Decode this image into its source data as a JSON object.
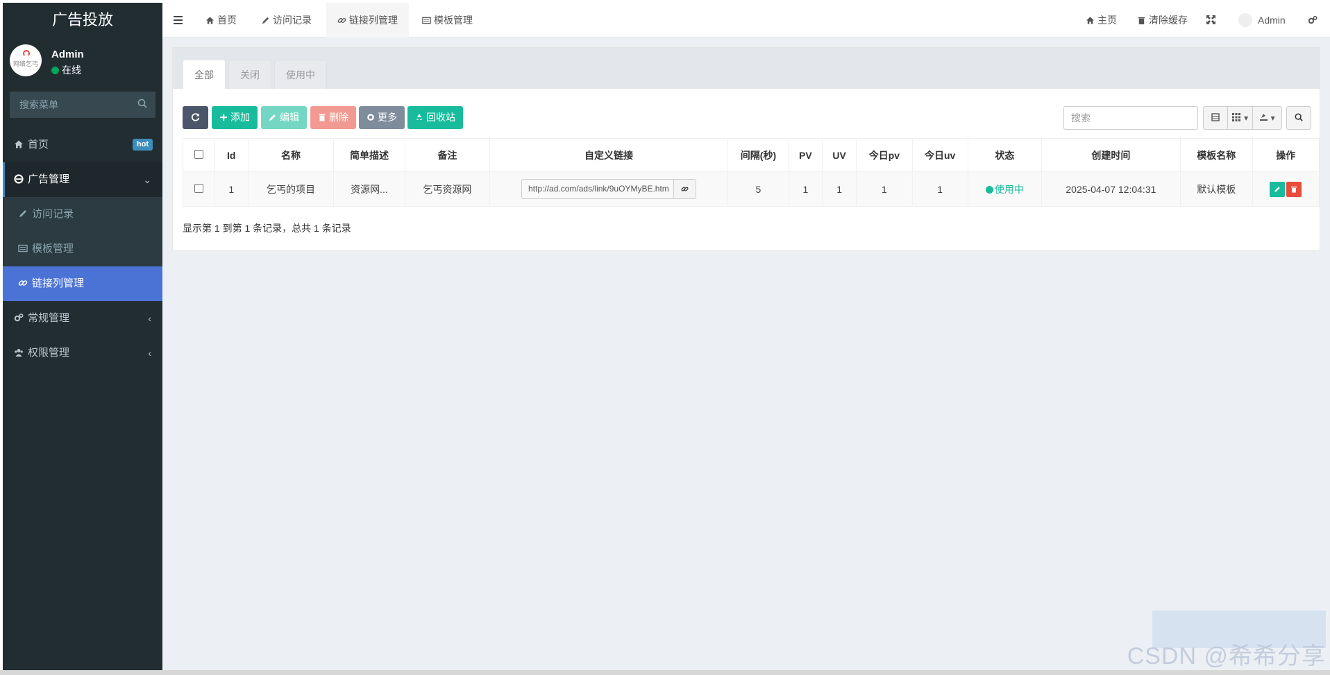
{
  "app": {
    "title": "广告投放"
  },
  "user": {
    "name": "Admin",
    "status": "在线",
    "avatar_text": "网络乞丐"
  },
  "sidebar": {
    "search_placeholder": "搜索菜单",
    "items": [
      {
        "label": "首页",
        "badge": "hot"
      },
      {
        "label": "广告管理",
        "caret": "⌄"
      },
      {
        "label": "访问记录"
      },
      {
        "label": "模板管理"
      },
      {
        "label": "链接列管理"
      },
      {
        "label": "常规管理",
        "caret": "‹"
      },
      {
        "label": "权限管理",
        "caret": "‹"
      }
    ]
  },
  "topbar": {
    "menu_icon": "hamburger-icon",
    "tabs": [
      {
        "label": "首页",
        "icon": "home-icon"
      },
      {
        "label": "访问记录",
        "icon": "pencil-icon"
      },
      {
        "label": "链接列管理",
        "icon": "link-icon"
      },
      {
        "label": "模板管理",
        "icon": "list-icon"
      }
    ],
    "right": {
      "home": "主页",
      "clear_cache": "清除缓存",
      "user": "Admin"
    }
  },
  "panel": {
    "tabs": [
      "全部",
      "关闭",
      "使用中"
    ],
    "buttons": {
      "refresh": "",
      "add": "添加",
      "edit": "编辑",
      "delete": "删除",
      "more": "更多",
      "recycle": "回收站"
    },
    "search_placeholder": "搜索",
    "colors": {
      "refresh": "#4c566a",
      "add": "#18bc9c",
      "edit": "#74d7c3",
      "delete": "#f29a91",
      "more": "#7f8c9b",
      "recycle": "#18bc9c"
    }
  },
  "table": {
    "headers": [
      "Id",
      "名称",
      "简单描述",
      "备注",
      "自定义链接",
      "间隔(秒)",
      "PV",
      "UV",
      "今日pv",
      "今日uv",
      "状态",
      "创建时间",
      "模板名称",
      "操作"
    ],
    "rows": [
      {
        "id": "1",
        "name": "乞丐的项目",
        "desc": "资源网...",
        "remark": "乞丐资源网",
        "link": "http://ad.com/ads/link/9uOYMyBE.htm",
        "interval": "5",
        "pv": "1",
        "uv": "1",
        "today_pv": "1",
        "today_uv": "1",
        "status": "使用中",
        "created": "2025-04-07 12:04:31",
        "template": "默认模板"
      }
    ],
    "pager": "显示第 1 到第 1 条记录，总共 1 条记录"
  },
  "watermark": "CSDN @希希分享"
}
